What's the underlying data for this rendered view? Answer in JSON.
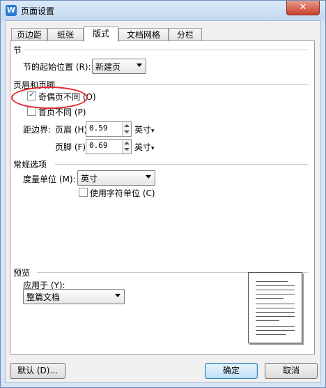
{
  "window": {
    "title": "页面设置",
    "app_icon": "W",
    "close": "✕"
  },
  "tabs": [
    "页边距",
    "纸张",
    "版式",
    "文档网格",
    "分栏"
  ],
  "section": {
    "heading": "节",
    "start_label": "节的起始位置 (R):",
    "start_value": "新建页"
  },
  "header_footer": {
    "heading": "页眉和页脚",
    "odd_even_label": "奇偶页不同 (O)",
    "odd_even_checked": true,
    "first_page_label": "首页不同 (P)",
    "first_page_checked": false,
    "distance_label": "距边界:",
    "header_label": "页眉 (H):",
    "header_value": "0.59",
    "header_unit": "英寸",
    "footer_label": "页脚 (F):",
    "footer_value": "0.69",
    "footer_unit": "英寸"
  },
  "general": {
    "heading": "常规选项",
    "unit_label": "度量单位 (M):",
    "unit_value": "英寸",
    "char_unit_label": "使用字符单位 (C)",
    "char_unit_checked": false
  },
  "preview": {
    "heading": "预览",
    "apply_label": "应用于 (Y):",
    "apply_value": "整篇文档"
  },
  "buttons": {
    "default": "默认 (D)...",
    "ok": "确定",
    "cancel": "取消"
  },
  "colors": {
    "highlight": "#e0262e"
  }
}
